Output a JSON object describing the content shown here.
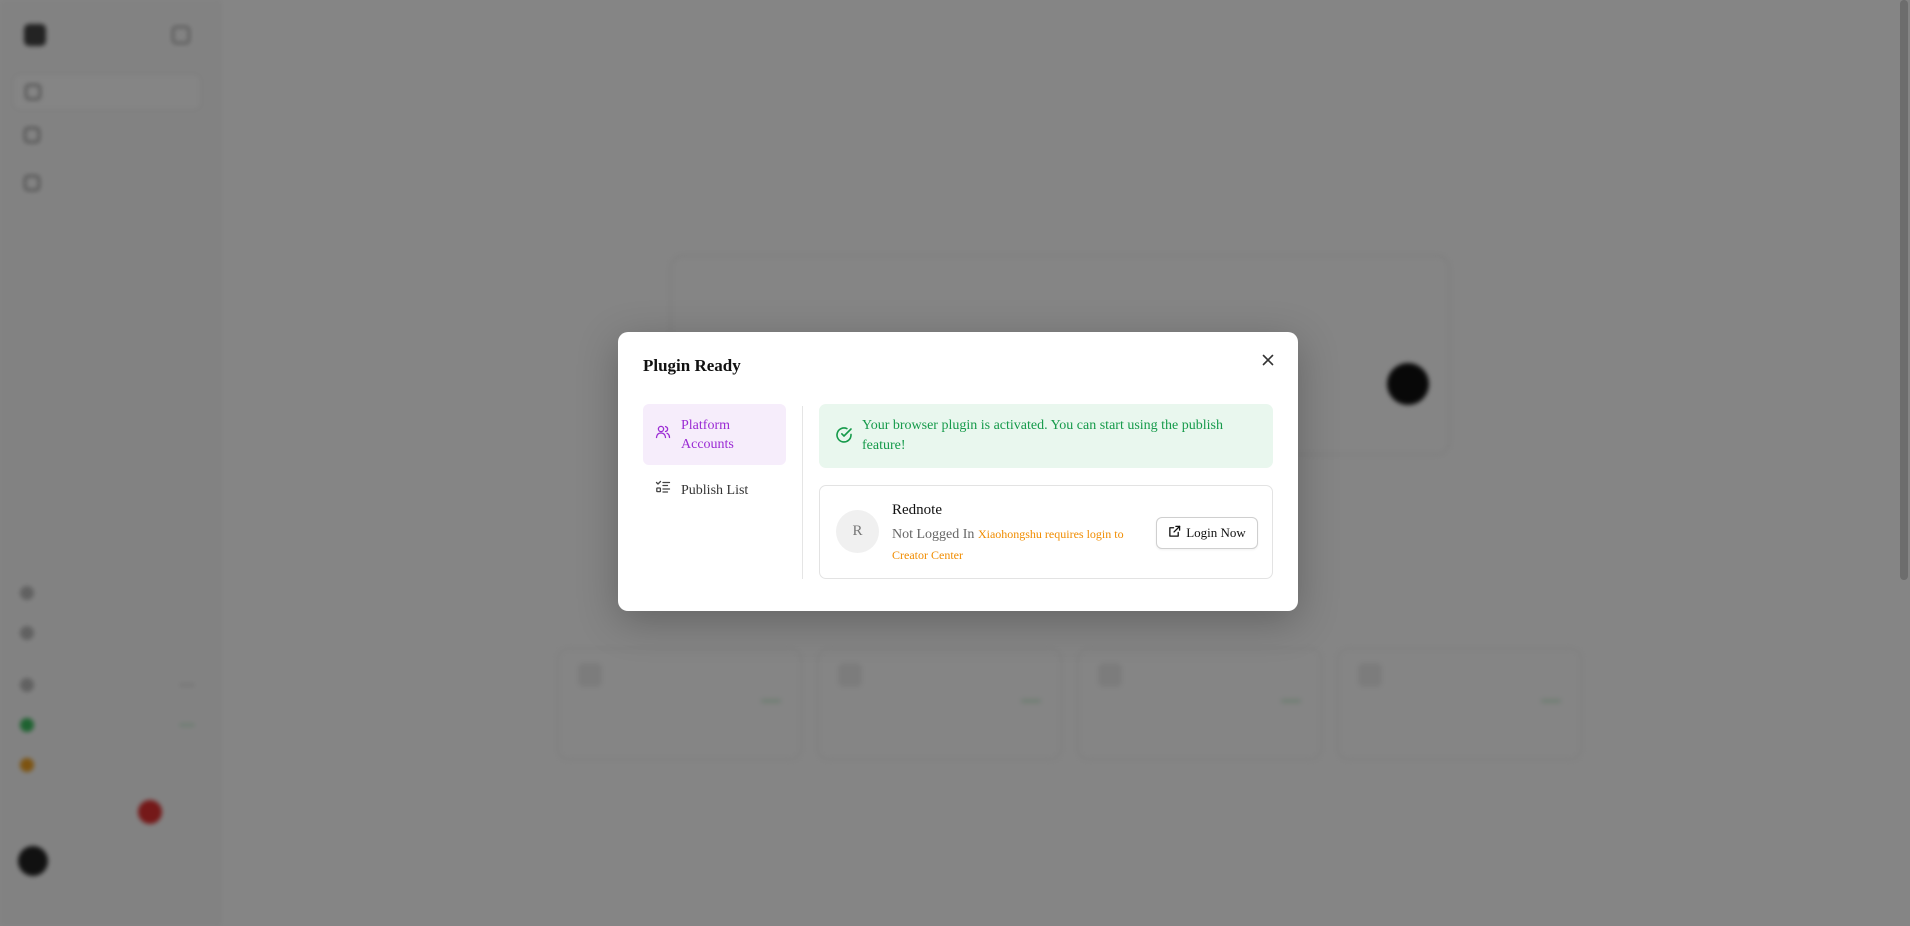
{
  "modal": {
    "title": "Plugin Ready",
    "nav": [
      {
        "label": "Platform Accounts",
        "icon": "users-icon",
        "active": true
      },
      {
        "label": "Publish List",
        "icon": "list-checks-icon",
        "active": false
      }
    ],
    "alert": {
      "icon": "check-circle-icon",
      "text": "Your browser plugin is activated. You can start using the publish feature!"
    },
    "account": {
      "avatar_letter": "R",
      "name": "Rednote",
      "status": "Not Logged In",
      "note": "Xiaohongshu requires login to Creator Center",
      "login_button": "Login Now",
      "login_icon": "external-link-icon"
    },
    "close_icon": "close-icon"
  },
  "colors": {
    "accent_purple": "#9b2bd4",
    "success_green": "#159a4a",
    "warning_orange": "#f08c00"
  }
}
